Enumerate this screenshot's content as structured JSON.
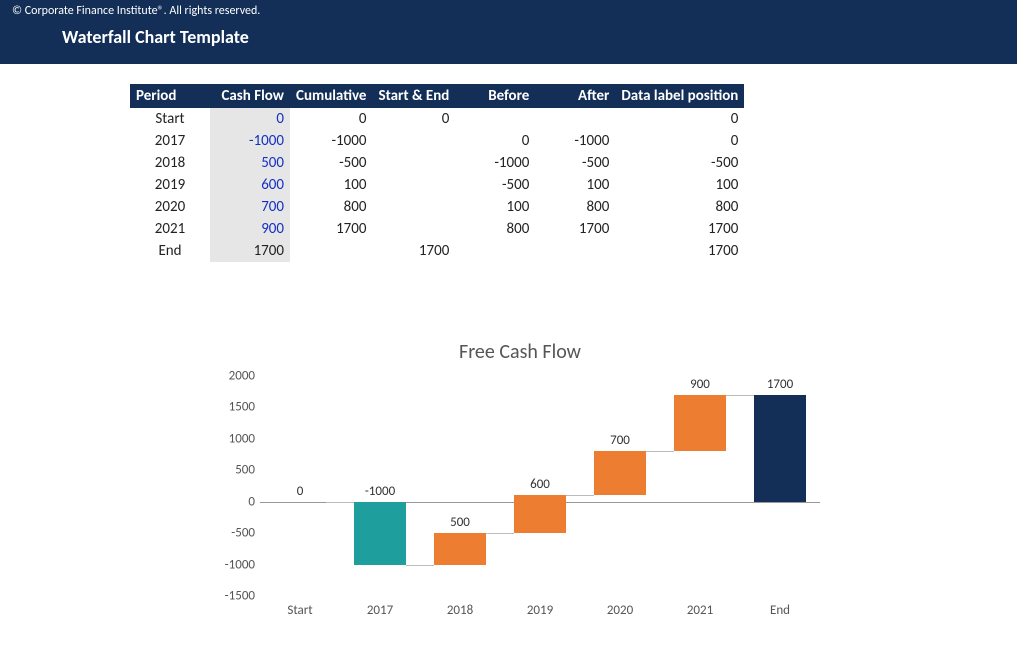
{
  "header": {
    "copyright": "© Corporate Finance Institute®. All rights reserved.",
    "title": "Waterfall Chart Template"
  },
  "table": {
    "headers": [
      "Period",
      "Cash Flow",
      "Cumulative",
      "Start & End",
      "Before",
      "After",
      "Data label position"
    ],
    "rows": [
      {
        "period": "Start",
        "cash_flow": "0",
        "cumulative": "0",
        "start_end": "0",
        "before": "",
        "after": "",
        "label_pos": "0"
      },
      {
        "period": "2017",
        "cash_flow": "-1000",
        "cumulative": "-1000",
        "start_end": "",
        "before": "0",
        "after": "-1000",
        "label_pos": "0"
      },
      {
        "period": "2018",
        "cash_flow": "500",
        "cumulative": "-500",
        "start_end": "",
        "before": "-1000",
        "after": "-500",
        "label_pos": "-500"
      },
      {
        "period": "2019",
        "cash_flow": "600",
        "cumulative": "100",
        "start_end": "",
        "before": "-500",
        "after": "100",
        "label_pos": "100"
      },
      {
        "period": "2020",
        "cash_flow": "700",
        "cumulative": "800",
        "start_end": "",
        "before": "100",
        "after": "800",
        "label_pos": "800"
      },
      {
        "period": "2021",
        "cash_flow": "900",
        "cumulative": "1700",
        "start_end": "",
        "before": "800",
        "after": "1700",
        "label_pos": "1700"
      },
      {
        "period": "End",
        "cash_flow": "1700",
        "cumulative": "",
        "start_end": "1700",
        "before": "",
        "after": "",
        "label_pos": "1700",
        "cash_black": true
      }
    ]
  },
  "chart_data": {
    "type": "bar",
    "title": "Free Cash Flow",
    "ylim": [
      -1500,
      2000
    ],
    "yticks": [
      -1500,
      -1000,
      -500,
      0,
      500,
      1000,
      1500,
      2000
    ],
    "categories": [
      "Start",
      "2017",
      "2018",
      "2019",
      "2020",
      "2021",
      "End"
    ],
    "series": [
      {
        "name": "Cash Flow",
        "values": [
          0,
          -1000,
          500,
          600,
          700,
          900,
          1700
        ]
      }
    ],
    "before": [
      0,
      0,
      -1000,
      -500,
      100,
      800,
      0
    ],
    "after": [
      0,
      -1000,
      -500,
      100,
      800,
      1700,
      1700
    ],
    "kind": [
      "start",
      "neg",
      "pos",
      "pos",
      "pos",
      "pos",
      "end"
    ],
    "data_labels": [
      "0",
      "-1000",
      "500",
      "600",
      "700",
      "900",
      "1700"
    ]
  }
}
